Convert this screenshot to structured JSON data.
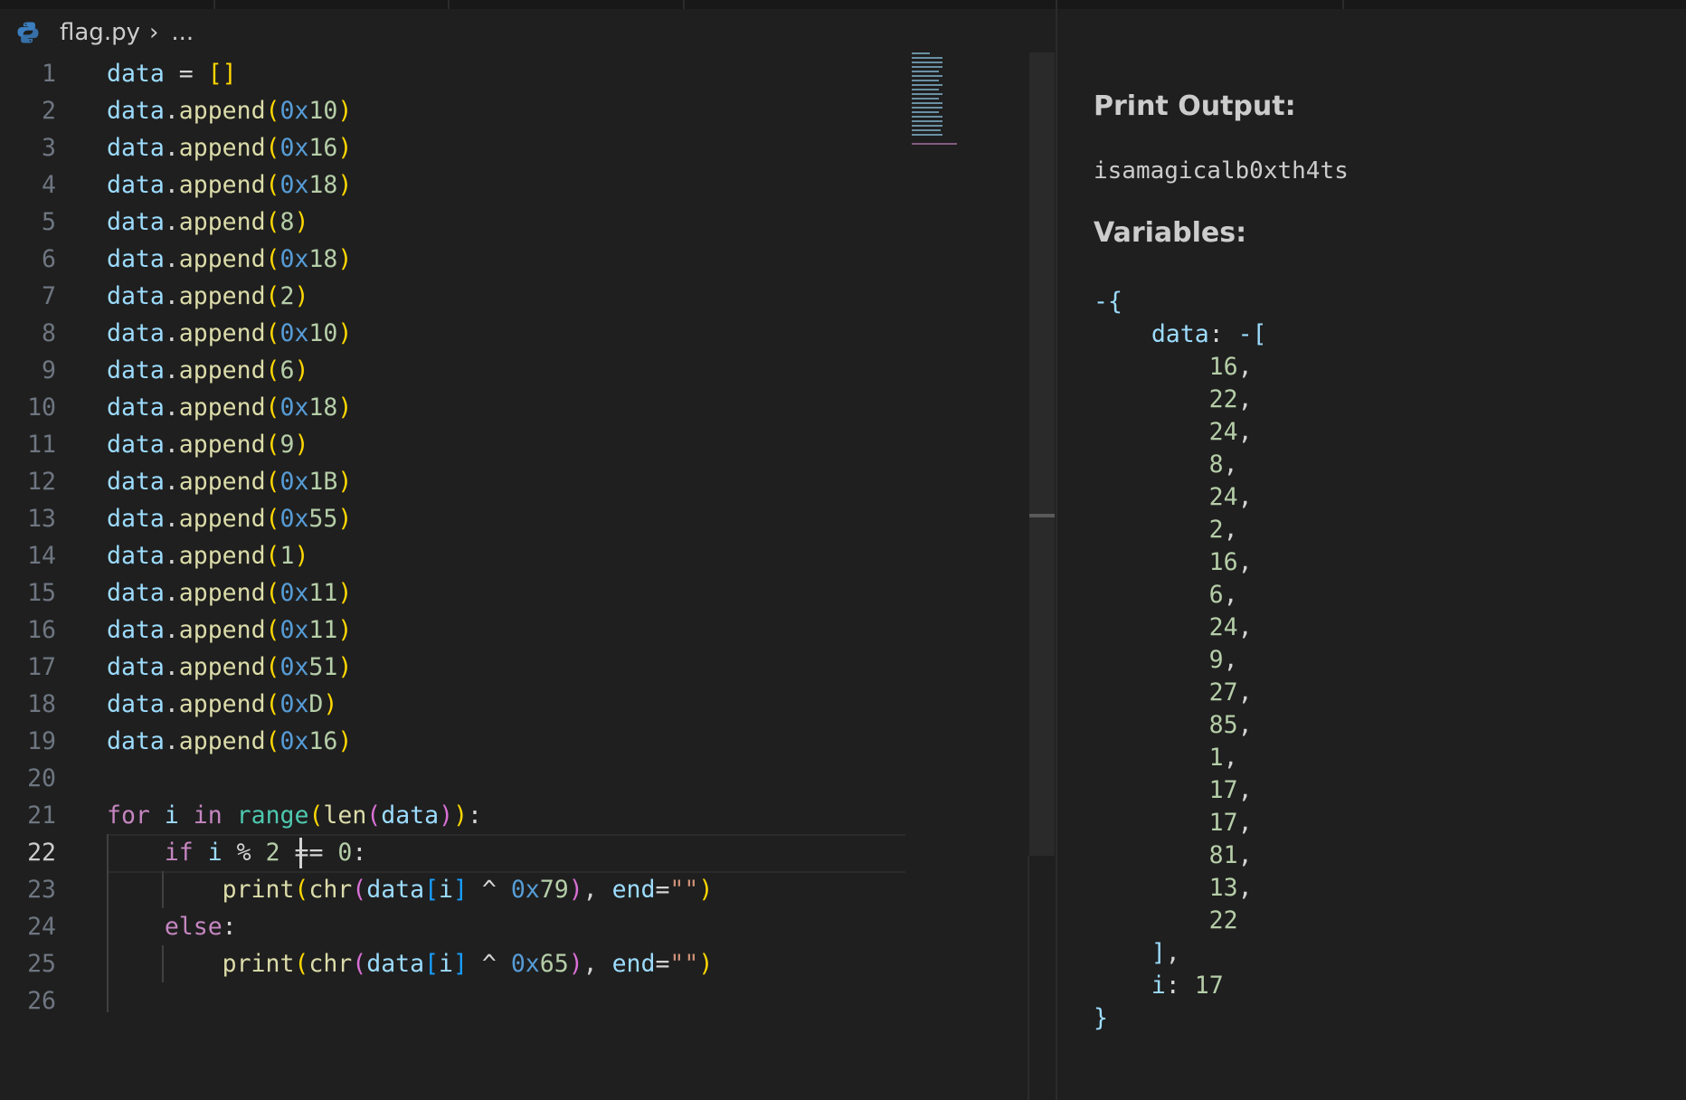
{
  "breadcrumb": {
    "file": "flag.py",
    "more": "..."
  },
  "editor": {
    "active_line": 22,
    "line_numbers": [
      "1",
      "2",
      "3",
      "4",
      "5",
      "6",
      "7",
      "8",
      "9",
      "10",
      "11",
      "12",
      "13",
      "14",
      "15",
      "16",
      "17",
      "18",
      "19",
      "20",
      "21",
      "22",
      "23",
      "24",
      "25",
      "26"
    ],
    "code": {
      "data_var": "data",
      "append_call": "data.append",
      "append_args": [
        "0x10",
        "0x16",
        "0x18",
        "8",
        "0x18",
        "2",
        "0x10",
        "6",
        "0x18",
        "9",
        "0x1B",
        "0x55",
        "1",
        "0x11",
        "0x11",
        "0x51",
        "0xD",
        "0x16"
      ],
      "line1": "data = []",
      "line21": "for i in range(len(data)):",
      "line22": "    if i % 2 == 0:",
      "line23": "        print(chr(data[i] ^ 0x79), end=\"\")",
      "line24": "    else:",
      "line25": "        print(chr(data[i] ^ 0x65), end=\"\")"
    }
  },
  "panel": {
    "print_heading": "Print Output:",
    "print_output": "isamagicalb0xth4ts",
    "variables_heading": "Variables:",
    "var_open": "-{",
    "data_key": "data: -[",
    "data_values": [
      "16,",
      "22,",
      "24,",
      "8,",
      "24,",
      "2,",
      "16,",
      "6,",
      "24,",
      "9,",
      "27,",
      "85,",
      "1,",
      "17,",
      "17,",
      "81,",
      "13,",
      "22"
    ],
    "data_close": "],",
    "i_key": "i:",
    "i_value": "17",
    "var_close": "}"
  },
  "colors": {
    "background": "#1f1f1f",
    "keyword": "#c586c0",
    "variable": "#9cdcfe",
    "function": "#dcdcaa",
    "number": "#b5cea8",
    "hex_prefix": "#569cd6",
    "bracket_level1": "#ffd700",
    "bracket_level2": "#da70d6",
    "bracket_level3": "#179fff"
  }
}
